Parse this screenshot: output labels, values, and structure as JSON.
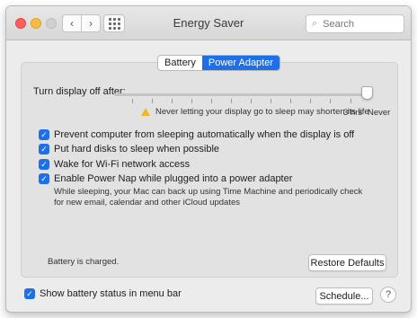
{
  "window": {
    "title": "Energy Saver",
    "search_placeholder": "Search"
  },
  "tabs": {
    "items": [
      "Battery",
      "Power Adapter"
    ],
    "active": "Power Adapter"
  },
  "slider": {
    "label": "Turn display off after:",
    "warning": "Never letting your display go to sleep may shorten its life",
    "mark_3hrs": "3 hrs",
    "mark_never": "Never",
    "value": "Never"
  },
  "options": [
    {
      "label": "Prevent computer from sleeping automatically when the display is off",
      "checked": true
    },
    {
      "label": "Put hard disks to sleep when possible",
      "checked": true
    },
    {
      "label": "Wake for Wi-Fi network access",
      "checked": true
    },
    {
      "label": "Enable Power Nap while plugged into a power adapter",
      "checked": true
    }
  ],
  "power_nap_description": "While sleeping, your Mac can back up using Time Machine and periodically check for new email, calendar and other iCloud updates",
  "status_text": "Battery is charged.",
  "buttons": {
    "restore_defaults": "Restore Defaults",
    "schedule": "Schedule...",
    "help": "?"
  },
  "bottom": {
    "show_battery_status": "Show battery status in menu bar",
    "checked": true
  },
  "icons": {
    "back": "chevron-left-icon",
    "forward": "chevron-right-icon",
    "grid": "grid-icon",
    "search": "search-icon",
    "warning": "warning-icon"
  },
  "colors": {
    "accent": "#1f6fe7",
    "close": "#fc605b",
    "minimize": "#fdbc40",
    "warning": "#f0b52b"
  }
}
